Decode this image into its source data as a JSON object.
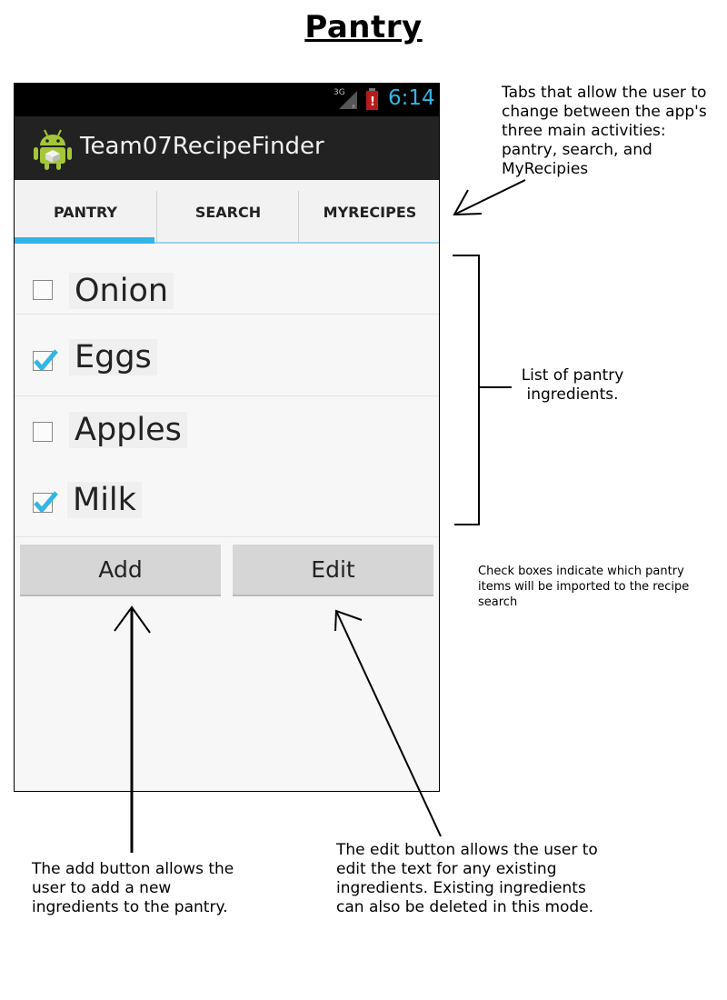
{
  "page": {
    "title": "Pantry"
  },
  "status_bar": {
    "network": "3G",
    "time": "6:14"
  },
  "app": {
    "title": "Team07RecipeFinder",
    "icon": "android-robot-icon"
  },
  "tabs": [
    {
      "label": "PANTRY",
      "active": true
    },
    {
      "label": "SEARCH",
      "active": false
    },
    {
      "label": "MYRECIPES",
      "active": false
    }
  ],
  "pantry": {
    "items": [
      {
        "label": "Onion",
        "checked": false
      },
      {
        "label": "Eggs",
        "checked": true
      },
      {
        "label": "Apples",
        "checked": false
      },
      {
        "label": "Milk",
        "checked": true
      }
    ]
  },
  "buttons": {
    "add": "Add",
    "edit": "Edit"
  },
  "annotations": {
    "tabs": "Tabs that allow the user to change between the app's three main activities: pantry, search, and MyRecipies",
    "list": "List of pantry ingredients.",
    "checkboxes": "Check boxes indicate which pantry items will be imported to the recipe search",
    "add": "The add button allows the user to add a new ingredients to the pantry.",
    "edit": "The edit button allows the user to edit the text for any existing ingredients. Existing ingredients can also be deleted in this mode."
  },
  "colors": {
    "accent": "#33b5e5",
    "action_bar": "#222222",
    "status_bar": "#000000"
  }
}
